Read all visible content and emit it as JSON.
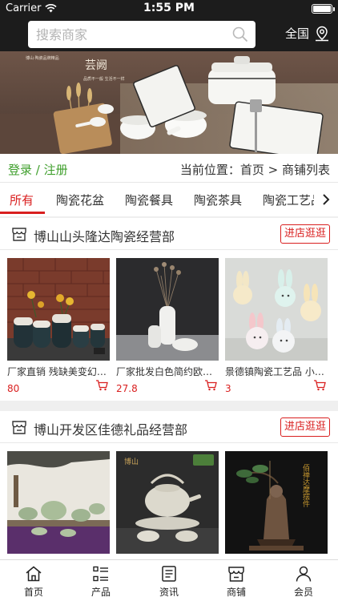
{
  "status": {
    "carrier": "Carrier",
    "time": "1:55 PM"
  },
  "header": {
    "search_placeholder": "搜索商家",
    "city": "全国"
  },
  "banner": {
    "brand": "芸阙",
    "slogan": "品质不一般 生活不一样",
    "tag": "博山·陶瓷品牌精品"
  },
  "nav": {
    "login": "登录",
    "slash": " / ",
    "register": "注册",
    "breadcrumb": "当前位置：首页 > 商铺列表"
  },
  "tabs": [
    "所有",
    "陶瓷花盆",
    "陶瓷餐具",
    "陶瓷茶具",
    "陶瓷工艺品"
  ],
  "shops": [
    {
      "name": "博山山头隆达陶瓷经营部",
      "enter_label": "进店逛逛",
      "products": [
        {
          "title": "厂家直销 残缺美变幻釉陶瓷花瓶",
          "price": "80"
        },
        {
          "title": "厂家批发白色简约欧式陶瓷花瓶",
          "price": "27.8"
        },
        {
          "title": "景德镇陶瓷工艺品 小兔子摆件",
          "price": "3"
        }
      ]
    },
    {
      "name": "博山开发区佳德礼品经营部",
      "enter_label": "进店逛逛",
      "products": [
        {
          "badge": ""
        },
        {
          "badge": "博山"
        },
        {
          "badge": "佰禅达摩摆件"
        }
      ]
    }
  ],
  "tabbar": [
    {
      "label": "首页",
      "icon": "home-icon"
    },
    {
      "label": "产品",
      "icon": "product-list-icon"
    },
    {
      "label": "资讯",
      "icon": "news-icon"
    },
    {
      "label": "商铺",
      "icon": "shop-icon"
    },
    {
      "label": "会员",
      "icon": "member-icon"
    }
  ]
}
